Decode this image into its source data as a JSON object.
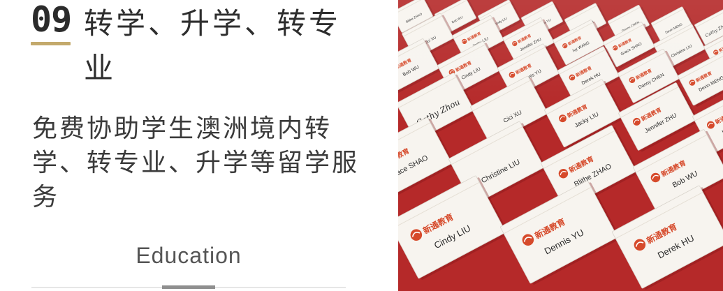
{
  "section": {
    "number": "09",
    "title": "转学、升学、转专业",
    "description": "免费协助学生澳洲境内转学、转专业、升学等留学服务",
    "tagline": "Education"
  },
  "photo": {
    "cards": [
      {
        "name": "Blithe ZHAO",
        "logo": "新通教育"
      },
      {
        "name": "Bob WU",
        "logo": "新通教育"
      },
      {
        "name": "Cindy LIU",
        "logo": "新通教育"
      },
      {
        "name": "Dennis YU",
        "logo": "新通教育"
      },
      {
        "name": "Derek HU",
        "logo": "新通教育"
      },
      {
        "name": "Danny CHEN",
        "logo": "新通教育"
      },
      {
        "name": "Devin MENG",
        "logo": "新通教育"
      },
      {
        "name": "Cathy Zhou",
        "logo": ""
      },
      {
        "name": "Cici XU",
        "logo": ""
      },
      {
        "name": "Jacky LIU",
        "logo": "新通教育"
      },
      {
        "name": "Jennifer ZHU",
        "logo": "新通教育"
      },
      {
        "name": "Ivy WANG",
        "logo": "新通教育"
      },
      {
        "name": "Grace SHAO",
        "logo": "新通教育"
      },
      {
        "name": "Christine LIU",
        "logo": ""
      }
    ],
    "tablecloth_color": "#c12c2c",
    "card_color": "#f7f4ef",
    "logo_color": "#d64a2b"
  },
  "colors": {
    "accent": "#c3a96c",
    "text_dark": "#2e2e2e",
    "divider": "#e6e6e6",
    "divider_active": "#8f8f8f"
  }
}
